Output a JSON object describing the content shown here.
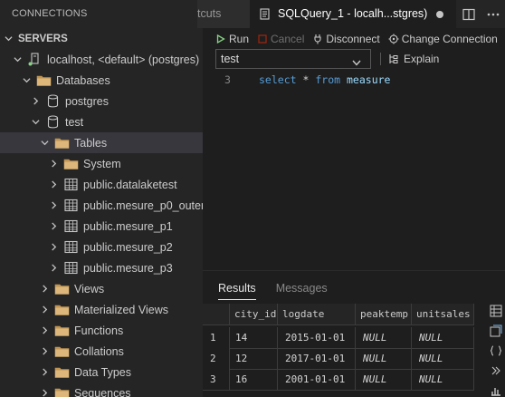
{
  "sidebar": {
    "title": "CONNECTIONS",
    "servers_header": "SERVERS",
    "tree": [
      {
        "id": "server",
        "label": "localhost, <default> (postgres)",
        "indent": 0,
        "twisty": "down",
        "icon": "server-icon"
      },
      {
        "id": "databases",
        "label": "Databases",
        "indent": 1,
        "twisty": "down",
        "icon": "folder-icon"
      },
      {
        "id": "db-postgres",
        "label": "postgres",
        "indent": 2,
        "twisty": "right",
        "icon": "database-icon"
      },
      {
        "id": "db-test",
        "label": "test",
        "indent": 2,
        "twisty": "down",
        "icon": "database-icon"
      },
      {
        "id": "tables",
        "label": "Tables",
        "indent": 3,
        "twisty": "down",
        "icon": "folder-icon",
        "selected": true
      },
      {
        "id": "system",
        "label": "System",
        "indent": 4,
        "twisty": "right",
        "icon": "folder-icon"
      },
      {
        "id": "t-datalaketest",
        "label": "public.datalaketest",
        "indent": 4,
        "twisty": "right",
        "icon": "table-icon"
      },
      {
        "id": "t-mesure-p0-outer",
        "label": "public.mesure_p0_outer",
        "indent": 4,
        "twisty": "right",
        "icon": "table-icon"
      },
      {
        "id": "t-mesure-p1",
        "label": "public.mesure_p1",
        "indent": 4,
        "twisty": "right",
        "icon": "table-icon"
      },
      {
        "id": "t-mesure-p2",
        "label": "public.mesure_p2",
        "indent": 4,
        "twisty": "right",
        "icon": "table-icon"
      },
      {
        "id": "t-mesure-p3",
        "label": "public.mesure_p3",
        "indent": 4,
        "twisty": "right",
        "icon": "table-icon"
      },
      {
        "id": "views",
        "label": "Views",
        "indent": 3,
        "twisty": "right",
        "icon": "folder-icon"
      },
      {
        "id": "mat-views",
        "label": "Materialized Views",
        "indent": 3,
        "twisty": "right",
        "icon": "folder-icon"
      },
      {
        "id": "functions",
        "label": "Functions",
        "indent": 3,
        "twisty": "right",
        "icon": "folder-icon"
      },
      {
        "id": "collations",
        "label": "Collations",
        "indent": 3,
        "twisty": "right",
        "icon": "folder-icon"
      },
      {
        "id": "data-types",
        "label": "Data Types",
        "indent": 3,
        "twisty": "right",
        "icon": "folder-icon"
      },
      {
        "id": "sequences",
        "label": "Sequences",
        "indent": 3,
        "twisty": "right",
        "icon": "folder-icon"
      }
    ]
  },
  "tabs": {
    "inactive_label": "tcuts",
    "active_label": "SQLQuery_1 - localh...stgres)"
  },
  "toolbar": {
    "run": "Run",
    "cancel": "Cancel",
    "disconnect": "Disconnect",
    "change_connection": "Change Connection",
    "explain": "Explain",
    "database": "test"
  },
  "editor": {
    "line_number": "3",
    "code": {
      "kw1": "select",
      "star": "*",
      "kw2": "from",
      "ident": "measure"
    }
  },
  "results": {
    "tab_results": "Results",
    "tab_messages": "Messages",
    "columns": [
      "city_id",
      "logdate",
      "peaktemp",
      "unitsales"
    ],
    "rows": [
      {
        "n": "1",
        "city_id": "14",
        "logdate": "2015-01-01",
        "peaktemp": "NULL",
        "unitsales": "NULL"
      },
      {
        "n": "2",
        "city_id": "12",
        "logdate": "2017-01-01",
        "peaktemp": "NULL",
        "unitsales": "NULL"
      },
      {
        "n": "3",
        "city_id": "16",
        "logdate": "2001-01-01",
        "peaktemp": "NULL",
        "unitsales": "NULL"
      }
    ]
  },
  "colors": {
    "accent_green": "#89d185",
    "keyword_blue": "#569cd6",
    "identifier_blue": "#9cdcfe",
    "selection_bg": "#37373d"
  }
}
